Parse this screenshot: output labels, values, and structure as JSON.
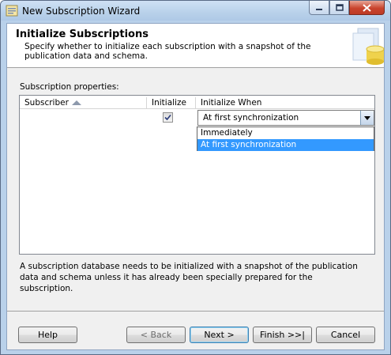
{
  "window": {
    "title": "New Subscription Wizard"
  },
  "header": {
    "title": "Initialize Subscriptions",
    "description": "Specify whether to initialize each subscription with a snapshot of the publication data and schema."
  },
  "properties": {
    "label": "Subscription properties:",
    "columns": {
      "subscriber": "Subscriber",
      "initialize": "Initialize",
      "initialize_when": "Initialize When"
    },
    "rows": [
      {
        "subscriber": "",
        "initialize": true,
        "initialize_when": "At first synchronization"
      }
    ],
    "dropdown_options": [
      "Immediately",
      "At first synchronization"
    ],
    "dropdown_selected_index": 1
  },
  "info_text": "A subscription database needs to be initialized with a snapshot of the publication data and schema unless it has already been specially prepared for the subscription.",
  "buttons": {
    "help": "Help",
    "back": "< Back",
    "next": "Next >",
    "finish": "Finish >>|",
    "cancel": "Cancel"
  },
  "colors": {
    "selection": "#3399ff",
    "titlebar": "#b9d1ea"
  }
}
